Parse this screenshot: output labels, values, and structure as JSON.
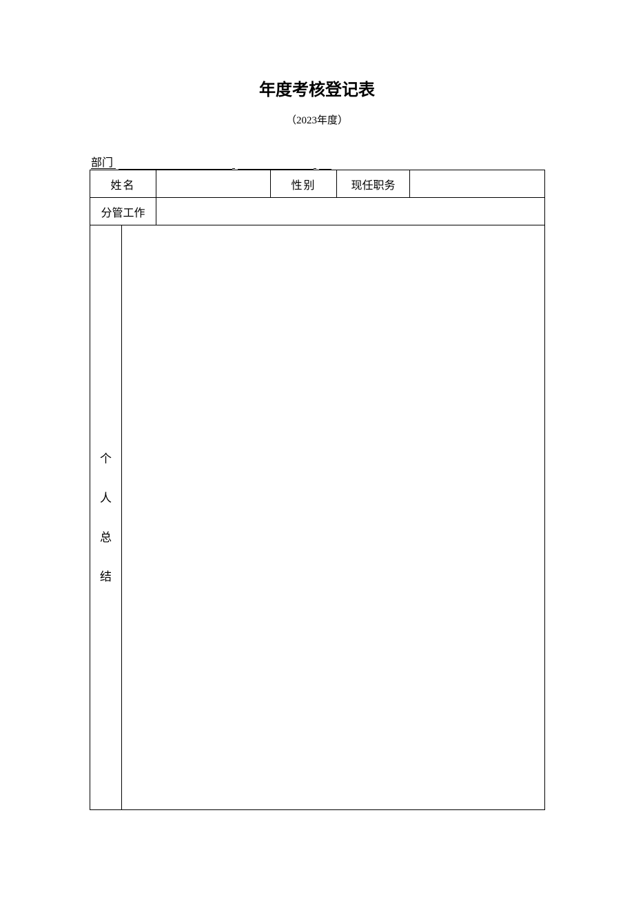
{
  "header": {
    "title": "年度考核登记表",
    "year_label": "（2023年度）"
  },
  "department": {
    "label": "部门"
  },
  "fields": {
    "name_label": "姓名",
    "name_value": "",
    "gender_label": "性别",
    "gender_value": "",
    "position_label": "现任职务",
    "position_value": "",
    "in_charge_label": "分管工作",
    "in_charge_value": ""
  },
  "summary": {
    "label_chars": [
      "个",
      "人",
      "总",
      "结"
    ],
    "content": ""
  }
}
